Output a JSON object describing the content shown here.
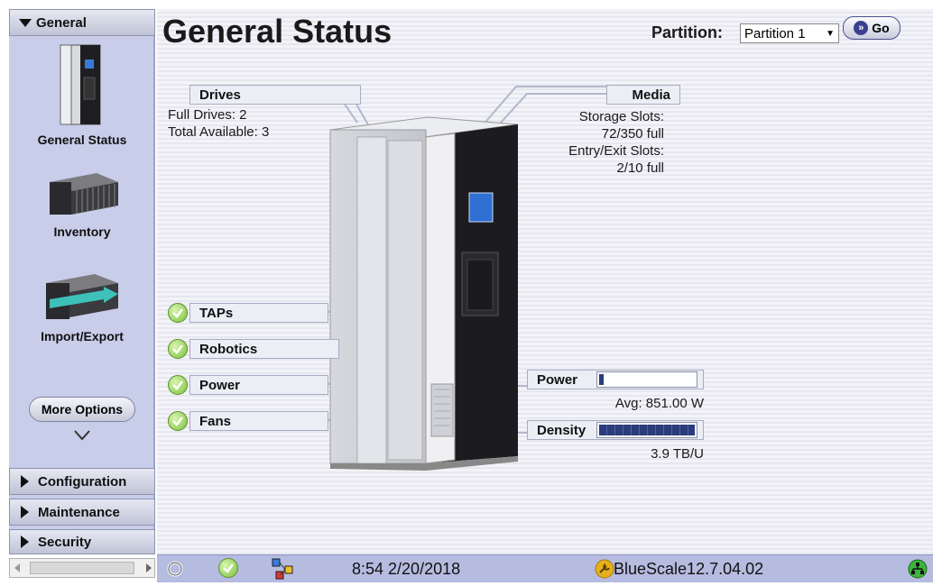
{
  "sidebar": {
    "general_label": "General",
    "items": [
      {
        "label": "General Status"
      },
      {
        "label": "Inventory"
      },
      {
        "label": "Import/Export"
      }
    ],
    "more_options_label": "More Options",
    "sections": [
      {
        "label": "Configuration"
      },
      {
        "label": "Maintenance"
      },
      {
        "label": "Security"
      }
    ]
  },
  "header": {
    "title": "General Status",
    "partition_label": "Partition:",
    "partition_value": "Partition 1",
    "go_label": "Go"
  },
  "drives": {
    "label": "Drives",
    "full_drives": "Full Drives: 2",
    "total_available": "Total Available: 3"
  },
  "media": {
    "label": "Media",
    "storage_slots_label": "Storage Slots:",
    "storage_slots_value": "72/350 full",
    "entry_exit_label": "Entry/Exit Slots:",
    "entry_exit_value": "2/10 full"
  },
  "status_items": [
    {
      "label": "TAPs"
    },
    {
      "label": "Robotics"
    },
    {
      "label": "Power"
    },
    {
      "label": "Fans"
    }
  ],
  "gauges": {
    "power_label": "Power",
    "power_level": 0.05,
    "power_avg": "Avg: 851.00 W",
    "density_label": "Density",
    "density_level": 1.0,
    "density_value": "3.9 TB/U"
  },
  "statusbar": {
    "datetime": "8:54 2/20/2018",
    "version": "BlueScale12.7.04.02"
  },
  "colors": {
    "sidebar_bg": "#c8cdea",
    "statusbar_bg": "#b6bbe0",
    "check_green": "#7cc13c"
  }
}
